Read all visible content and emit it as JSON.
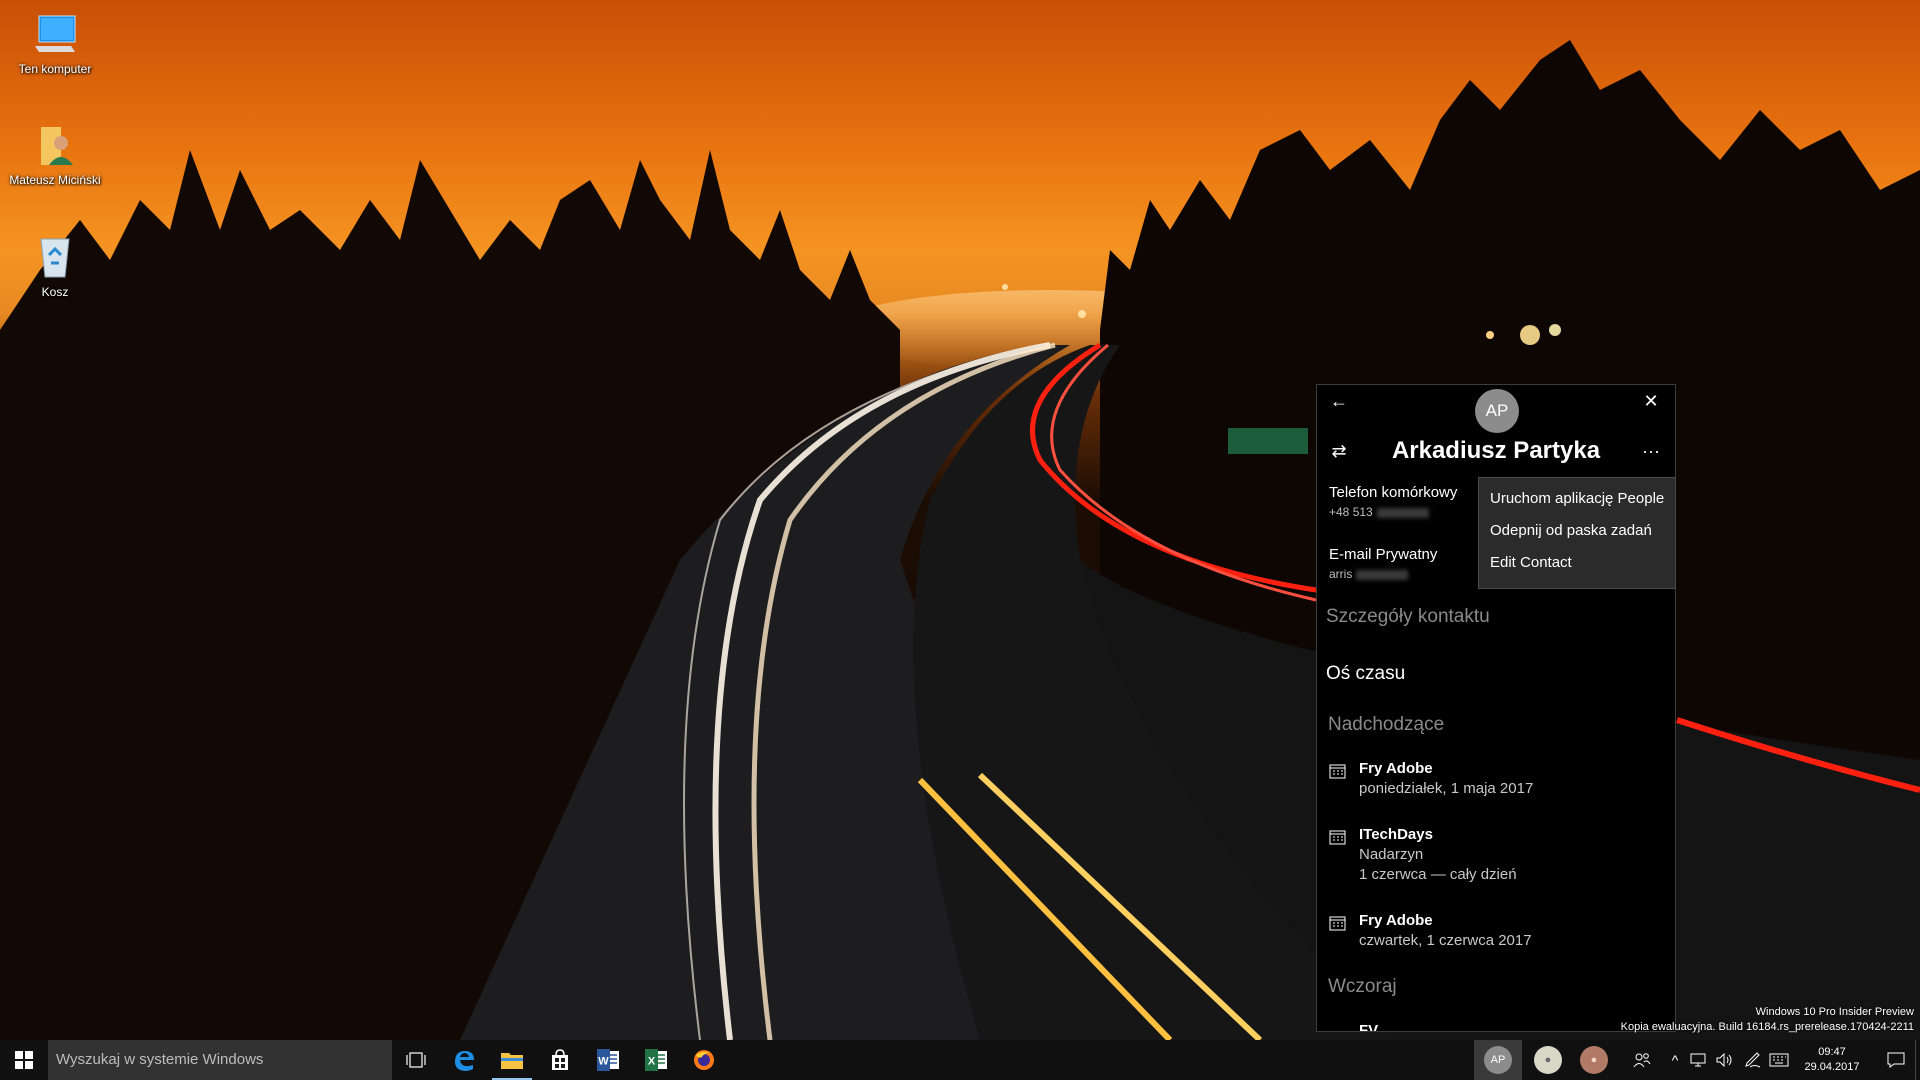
{
  "desktop": {
    "icons": [
      {
        "label": "Ten komputer",
        "icon": "computer-icon"
      },
      {
        "label": "Mateusz Miciński",
        "icon": "user-folder-icon"
      },
      {
        "label": "Kosz",
        "icon": "recycle-bin-icon"
      }
    ]
  },
  "people_flyout": {
    "avatar_initials": "AP",
    "contact_name": "Arkadiusz Partyka",
    "phone": {
      "label": "Telefon komórkowy",
      "value": "+48 513"
    },
    "email": {
      "label": "E-mail Prywatny",
      "value": "arris"
    },
    "details_link": "Szczegóły kontaktu",
    "timeline_title": "Oś czasu",
    "upcoming_title": "Nadchodzące",
    "events": [
      {
        "title": "Fry Adobe",
        "lines": [
          "poniedziałek, 1 maja 2017"
        ]
      },
      {
        "title": "ITechDays",
        "lines": [
          "Nadarzyn",
          "1 czerwca — cały dzień"
        ]
      },
      {
        "title": "Fry Adobe",
        "lines": [
          "czwartek, 1 czerwca 2017"
        ]
      }
    ],
    "yesterday_title": "Wczoraj",
    "partial_event_title": "FV",
    "context_menu": [
      "Uruchom aplikację People",
      "Odepnij od paska zadań",
      "Edit Contact"
    ]
  },
  "watermark": {
    "line1": "Windows 10 Pro Insider Preview",
    "line2": "Kopia ewaluacyjna. Build 16184.rs_prerelease.170424-2211"
  },
  "taskbar": {
    "search_placeholder": "Wyszukaj w systemie Windows",
    "pinned_apps": [
      "task-view-icon",
      "edge-icon",
      "file-explorer-icon",
      "store-icon",
      "word-icon",
      "excel-icon",
      "firefox-icon"
    ],
    "people_contact_initials": "AP",
    "clock_time": "09:47",
    "clock_date": "29.04.2017",
    "colors": {
      "accent_underline": "#99c6ef",
      "taskbar_bg": "#101010"
    }
  }
}
